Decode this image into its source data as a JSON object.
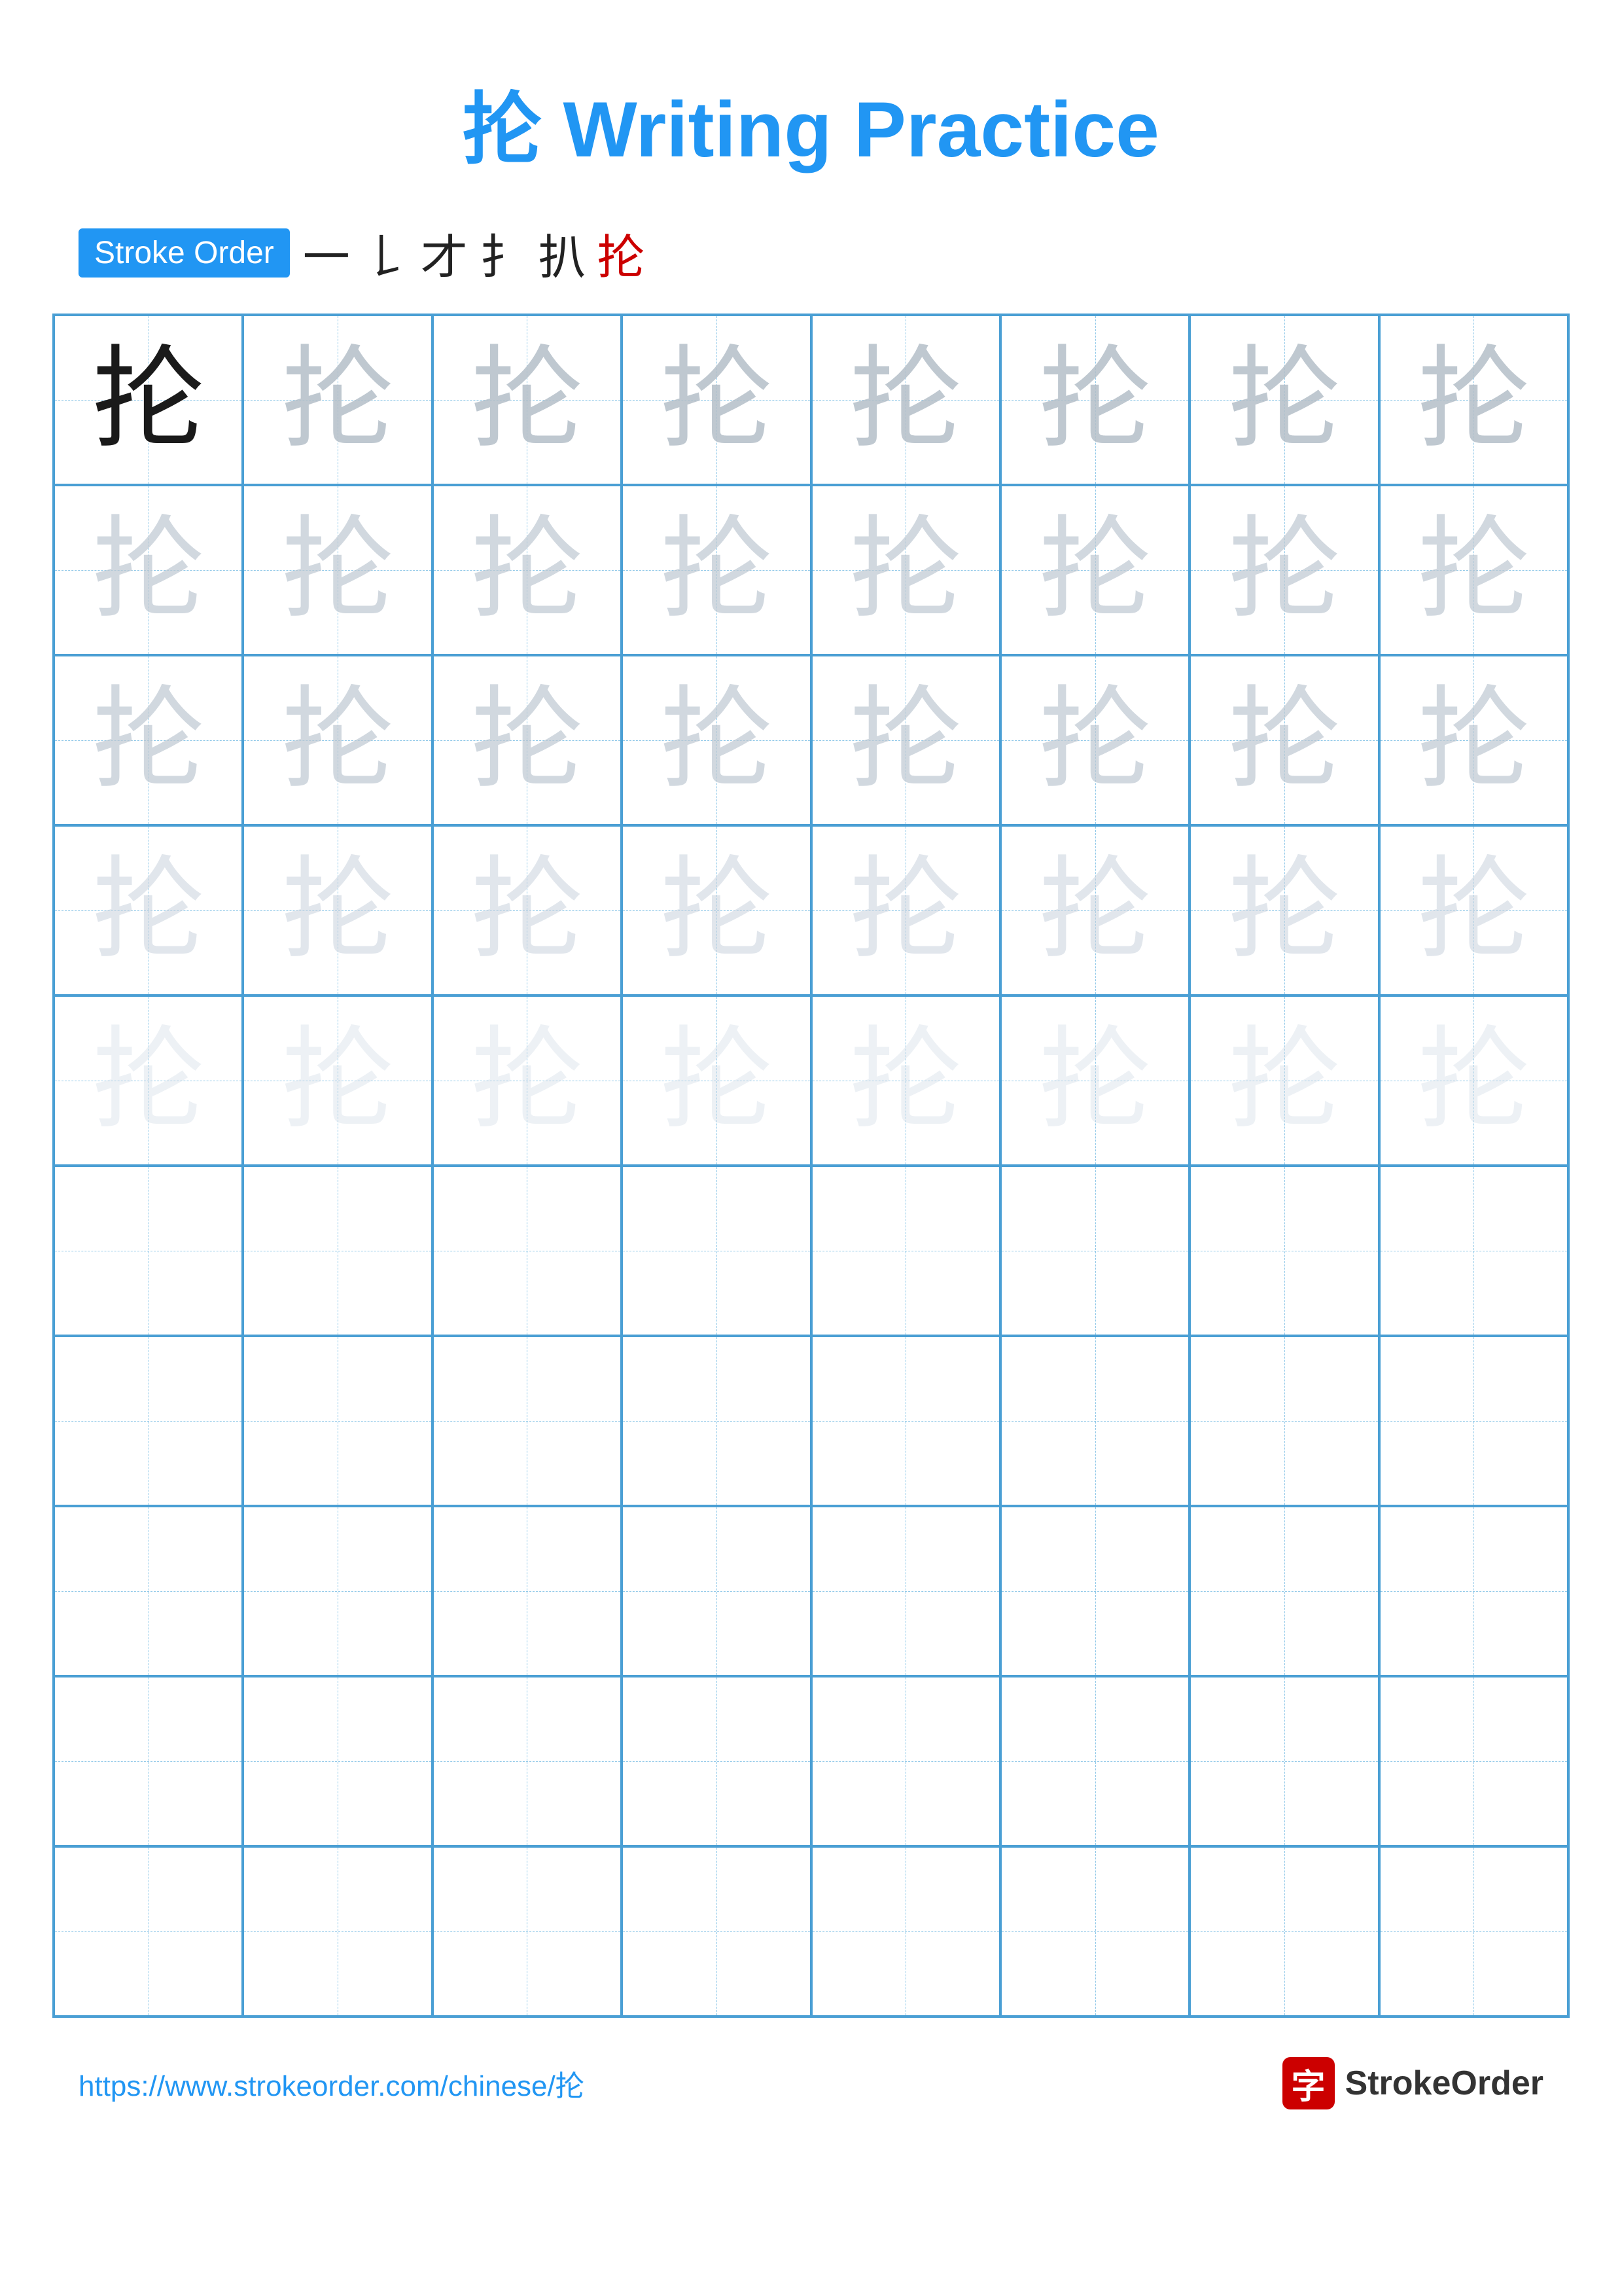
{
  "title": {
    "character": "抡",
    "label": "Writing Practice",
    "full": "抡 Writing Practice"
  },
  "stroke_order": {
    "badge_label": "Stroke Order",
    "strokes": [
      "一",
      "𠄌",
      "才",
      "扌",
      "扒",
      "抡",
      "抡"
    ],
    "display_strokes": [
      {
        "char": "一",
        "red": false
      },
      {
        "char": "𠄌",
        "red": false
      },
      {
        "char": "才",
        "red": false
      },
      {
        "char": "扌",
        "red": false
      },
      {
        "char": "扒",
        "red": false
      },
      {
        "char": "抡",
        "red": true
      }
    ]
  },
  "grid": {
    "cols": 8,
    "rows": 10,
    "character": "抡",
    "ghost_rows": 5,
    "empty_rows": 5
  },
  "footer": {
    "url": "https://www.strokeorder.com/chinese/抡",
    "brand_char": "字",
    "brand_name": "StrokeOrder"
  },
  "colors": {
    "blue": "#2196F3",
    "red": "#cc0000",
    "grid_border": "#4a9fd4",
    "grid_dash": "#90c8e8"
  }
}
